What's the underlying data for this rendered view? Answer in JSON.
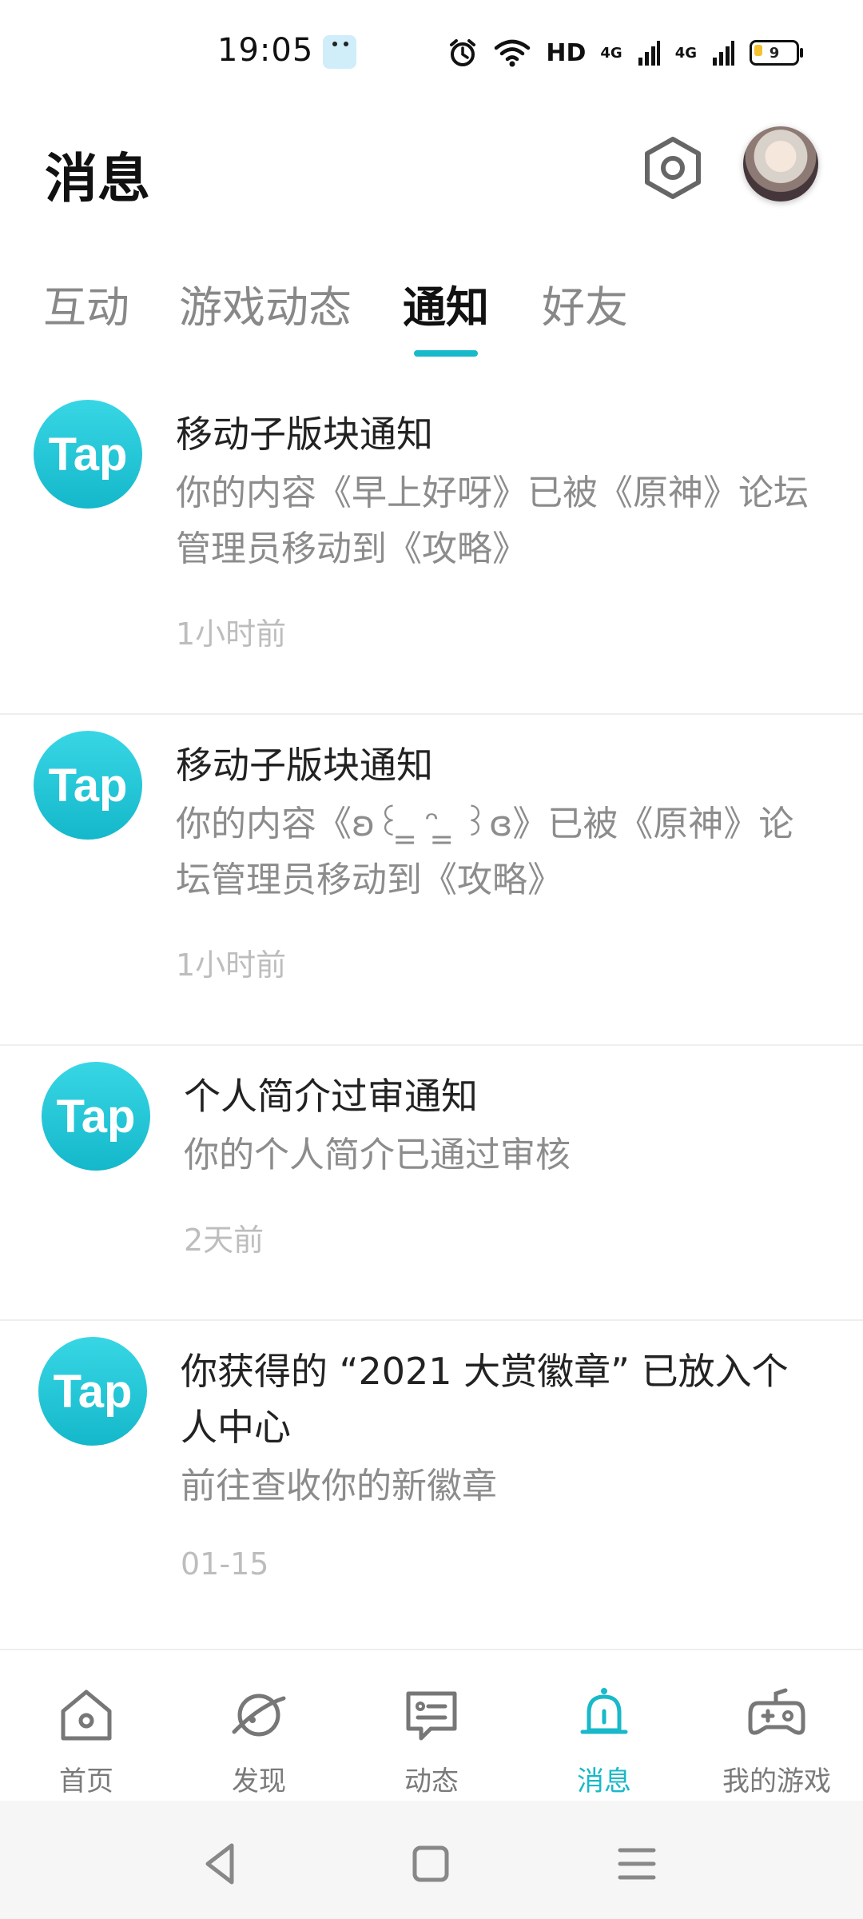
{
  "status_bar": {
    "time": "19:05",
    "network_hd": "HD",
    "network_4g_1": "4G",
    "network_4g_2": "4G",
    "battery_level": "9"
  },
  "header": {
    "title": "消息"
  },
  "tabs": [
    {
      "label": "互动",
      "active": false
    },
    {
      "label": "游戏动态",
      "active": false
    },
    {
      "label": "通知",
      "active": true
    },
    {
      "label": "好友",
      "active": false
    }
  ],
  "notifications": [
    {
      "logo_text": "Tap",
      "title": "移动子版块通知",
      "description": "你的内容《早上好呀》已被《原神》论坛管理员移动到《攻略》",
      "time": "1小时前"
    },
    {
      "logo_text": "Tap",
      "title": "移动子版块通知",
      "description": "你的内容《ʚ꒰ ̳ ᵔ ̳ ꒱ɞ》已被《原神》论坛管理员移动到《攻略》",
      "time": "1小时前"
    },
    {
      "logo_text": "Tap",
      "title": "个人简介过审通知",
      "description": "你的个人简介已通过审核",
      "time": "2天前"
    },
    {
      "logo_text": "Tap",
      "title": "你获得的 “2021 大赏徽章” 已放入个人中心",
      "description": "前往查收你的新徽章",
      "time": "01-15"
    }
  ],
  "bottom_nav": [
    {
      "label": "首页",
      "icon": "home-icon",
      "active": false
    },
    {
      "label": "发现",
      "icon": "discover-planet-icon",
      "active": false
    },
    {
      "label": "动态",
      "icon": "feed-card-icon",
      "active": false
    },
    {
      "label": "消息",
      "icon": "bell-icon",
      "active": true
    },
    {
      "label": "我的游戏",
      "icon": "gamepad-icon",
      "active": false
    }
  ],
  "colors": {
    "accent": "#18b9c9",
    "tap_logo": "#1cc0d0"
  }
}
